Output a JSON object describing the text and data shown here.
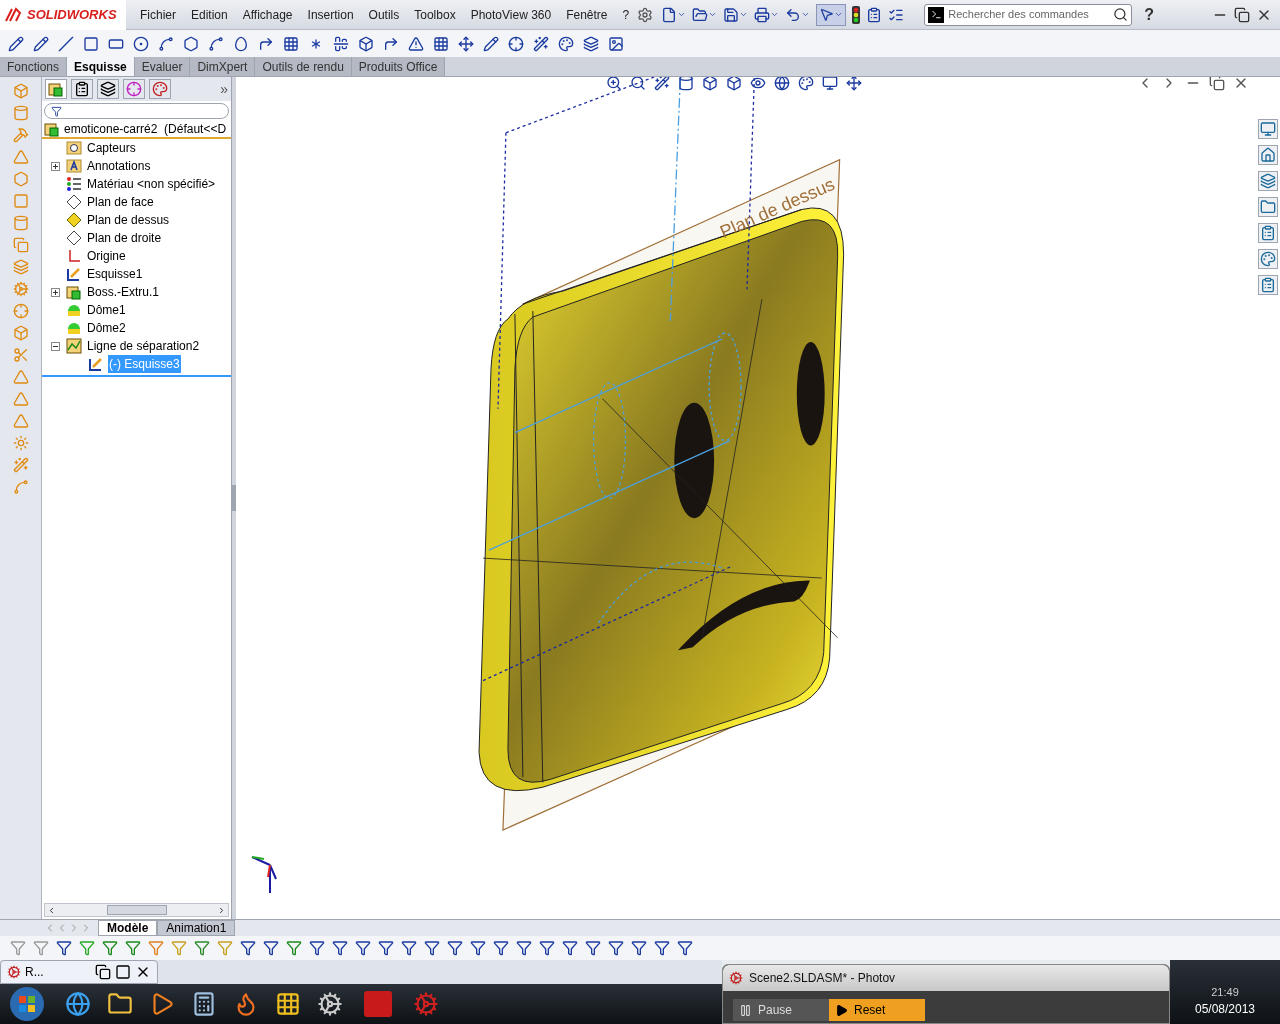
{
  "app": {
    "logo": "SOLIDWORKS"
  },
  "menu": [
    "Fichier",
    "Edition",
    "Affichage",
    "Insertion",
    "Outils",
    "Toolbox",
    "PhotoView 360",
    "Fenêtre",
    "?"
  ],
  "search": {
    "placeholder": "Rechercher des commandes"
  },
  "help": "?",
  "command_tabs": [
    {
      "label": "Fonctions",
      "selected": false
    },
    {
      "label": "Esquisse",
      "selected": true
    },
    {
      "label": "Evaluer",
      "selected": false
    },
    {
      "label": "DimXpert",
      "selected": false
    },
    {
      "label": "Outils de rendu",
      "selected": false
    },
    {
      "label": "Produits Office",
      "selected": false
    }
  ],
  "feature_tree": {
    "more": "»",
    "root": "emoticone-carré2  (Défaut<<D",
    "items": [
      {
        "label": "Capteurs",
        "kind": "sensor",
        "selected": false
      },
      {
        "label": "Annotations",
        "kind": "annotation",
        "selected": false,
        "expanded": false
      },
      {
        "label": "Matériau <non spécifié>",
        "kind": "material",
        "selected": false
      },
      {
        "label": "Plan de face",
        "kind": "plane",
        "selected": false
      },
      {
        "label": "Plan de dessus",
        "kind": "plane_shown",
        "selected": false
      },
      {
        "label": "Plan de droite",
        "kind": "plane",
        "selected": false
      },
      {
        "label": "Origine",
        "kind": "origin",
        "selected": false
      },
      {
        "label": "Esquisse1",
        "kind": "sketch",
        "selected": false
      },
      {
        "label": "Boss.-Extru.1",
        "kind": "extrude",
        "selected": false,
        "expanded": false
      },
      {
        "label": "Dôme1",
        "kind": "dome",
        "selected": false
      },
      {
        "label": "Dôme2",
        "kind": "dome",
        "selected": false
      },
      {
        "label": "Ligne de séparation2",
        "kind": "split",
        "selected": false,
        "expanded": true,
        "children": [
          {
            "label": "(-) Esquisse3",
            "kind": "sketch",
            "selected": true
          }
        ]
      }
    ]
  },
  "viewport": {
    "plane_label": "Plan de dessus"
  },
  "bottom_tabs": [
    {
      "label": "Modèle",
      "selected": true
    },
    {
      "label": "Animation1",
      "selected": false
    }
  ],
  "minimized_window": {
    "title": "R..."
  },
  "photoview": {
    "title": "Scene2.SLDASM* - Photov",
    "buttons": [
      {
        "label": "Pause",
        "selected": false
      },
      {
        "label": "Reset",
        "selected": true
      }
    ]
  },
  "clock": {
    "time": "21:49",
    "date": "05/08/2013"
  }
}
